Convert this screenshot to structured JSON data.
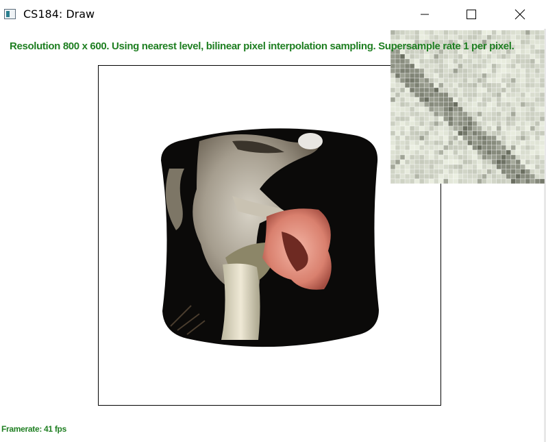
{
  "window": {
    "title": "CS184: Draw",
    "icon": "app-icon",
    "controls": {
      "minimize": "minimize-icon",
      "maximize": "maximize-icon",
      "close": "close-icon"
    }
  },
  "status": {
    "text": "Resolution 800 x 600. Using nearest level, bilinear pixel interpolation sampling. Supersample rate 1 per pixel."
  },
  "canvas": {
    "image": "texture-mapped-squirrel-image",
    "zoom_view": "pixel-inspector-zoom"
  },
  "footer": {
    "framerate": "Framerate: 41 fps"
  },
  "colors": {
    "status_green": "#1f7f22",
    "canvas_border": "#000000",
    "background": "#ffffff"
  }
}
